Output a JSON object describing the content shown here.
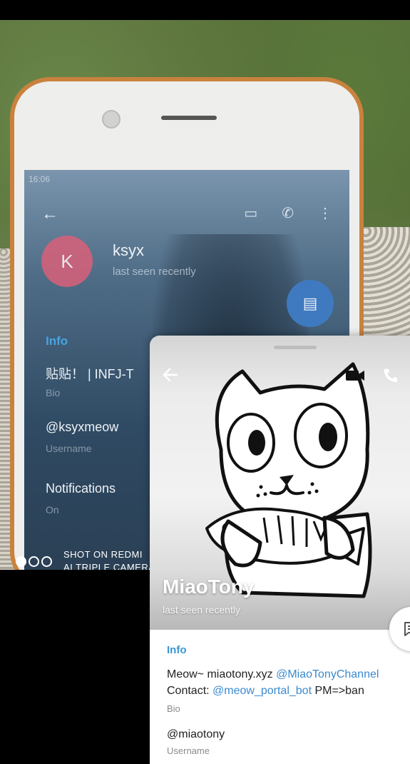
{
  "photo_screen": {
    "status_text": "16:06",
    "contact_initial": "K",
    "contact_name": "ksyx",
    "contact_status": "last seen recently",
    "info_label": "Info",
    "bio_text": "贴贴！ | INFJ-T",
    "bio_label": "Bio",
    "username": "@ksyxmeow",
    "username_label": "Username",
    "notifications_label": "Notifications",
    "notifications_value": "On"
  },
  "watermark": {
    "line1": "SHOT ON REDMI",
    "line2": "AI TRIPLE CAMERA"
  },
  "profile": {
    "name": "MiaoTony",
    "status": "last seen recently",
    "info_label": "Info",
    "bio_prefix": "Meow~ miaotony.xyz ",
    "bio_link_channel": "@MiaoTonyChannel",
    "bio_contact_prefix": "Contact: ",
    "bio_link_bot": "@meow_portal_bot",
    "bio_suffix": " PM=>ban",
    "bio_label": "Bio",
    "username": "@miaotony",
    "username_label": "Username"
  },
  "colors": {
    "accent": "#3a95d5",
    "link": "#3a8ad0",
    "phone_case": "#c9823e"
  }
}
